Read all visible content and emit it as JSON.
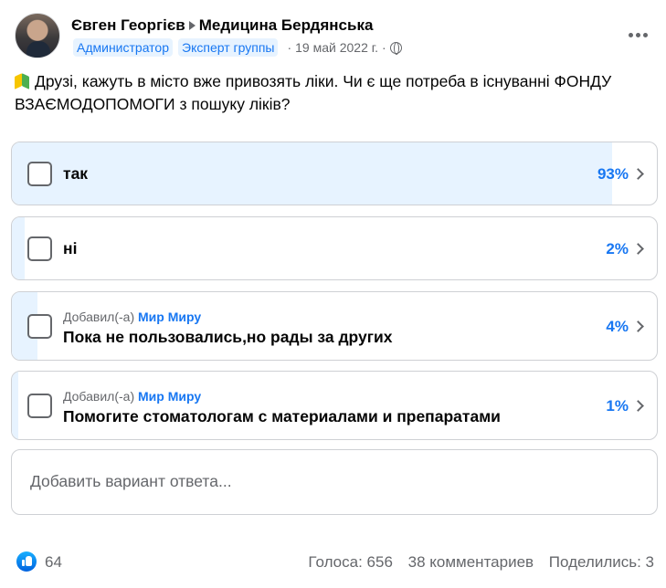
{
  "post": {
    "author": "Євген Георгієв",
    "group": "Медицина Бердянська",
    "badges": [
      "Администратор",
      "Эксперт группы"
    ],
    "date": "19 май 2022 г.",
    "privacy_icon": "globe-icon",
    "more_icon": "more-options-icon",
    "text": "Друзі, кажуть в місто вже привозять ліки. Чи є ще потреба в існуванні ФОНДУ ВЗАЄМОДОПОМОГИ з пошуку ліків?",
    "text_icon": "beginner-leaf-icon"
  },
  "poll": {
    "options": [
      {
        "label": "так",
        "percent_label": "93%",
        "percent": 93,
        "added_prefix": "",
        "added_by": ""
      },
      {
        "label": "ні",
        "percent_label": "2%",
        "percent": 2,
        "added_prefix": "",
        "added_by": ""
      },
      {
        "label": "Пока не пользовались,но рады за других",
        "percent_label": "4%",
        "percent": 4,
        "added_prefix": "Добавил(-а)",
        "added_by": "Мир Миру"
      },
      {
        "label": "Помогите стоматологам с материалами и препаратами",
        "percent_label": "1%",
        "percent": 1,
        "added_prefix": "Добавил(-а)",
        "added_by": "Мир Миру"
      }
    ],
    "add_placeholder": "Добавить вариант ответа..."
  },
  "footer": {
    "likes": "64",
    "votes": "Голоса: 656",
    "comments": "38 комментариев",
    "shares": "Поделились: 3"
  },
  "colors": {
    "accent": "#1877f2",
    "fill": "#e7f3ff",
    "secondary_text": "#65676b"
  }
}
